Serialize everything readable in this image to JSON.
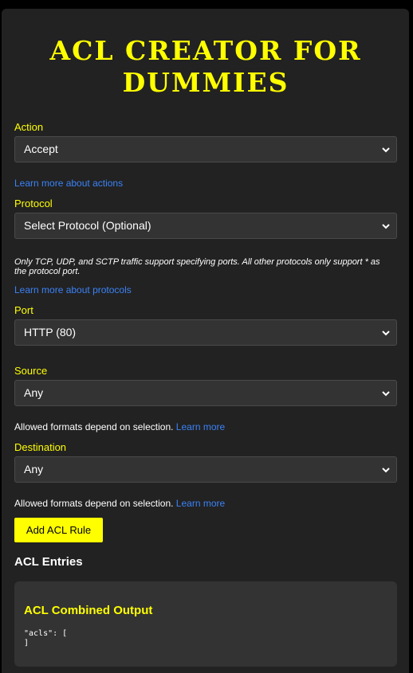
{
  "title": "ACL CREATOR FOR DUMMIES",
  "action": {
    "label": "Action",
    "selected": "Accept",
    "learn_more": "Learn more about actions"
  },
  "protocol": {
    "label": "Protocol",
    "selected": "Select Protocol (Optional)",
    "note": "Only TCP, UDP, and SCTP traffic support specifying ports. All other protocols only support * as the protocol port.",
    "learn_more": "Learn more about protocols"
  },
  "port": {
    "label": "Port",
    "selected": "HTTP (80)"
  },
  "source": {
    "label": "Source",
    "selected": "Any",
    "helper": "Allowed formats depend on selection.",
    "learn_more": "Learn more"
  },
  "destination": {
    "label": "Destination",
    "selected": "Any",
    "helper": "Allowed formats depend on selection.",
    "learn_more": "Learn more"
  },
  "add_button": "Add ACL Rule",
  "entries_heading": "ACL Entries",
  "output": {
    "title": "ACL Combined Output",
    "code": "\"acls\": [\n]"
  },
  "colors": {
    "accent": "#ffff00",
    "link": "#3b82f6",
    "panel": "#222222",
    "field": "#333333"
  },
  "icons": [
    "chevron-down-icon"
  ]
}
